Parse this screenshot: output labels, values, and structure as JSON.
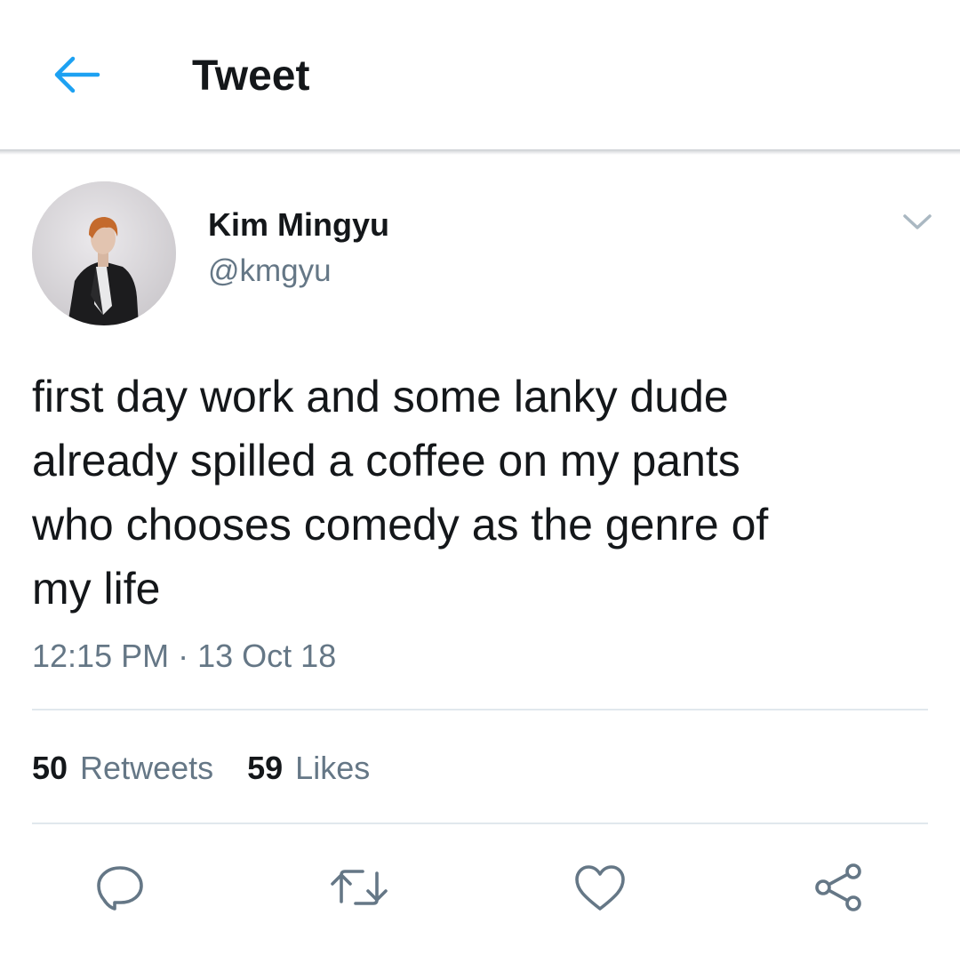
{
  "header": {
    "title": "Tweet",
    "back_icon": "arrow-left-icon",
    "accent_color": "#1da1f2"
  },
  "author": {
    "display_name": "Kim Mingyu",
    "handle": "@kmgyu",
    "menu_icon": "chevron-down-icon"
  },
  "tweet": {
    "text": "first day work and some lanky dude\nalready spilled a coffee on my pants\nwho chooses comedy as the genre of\nmy life",
    "time": "12:15 PM",
    "separator": "·",
    "date": "13 Oct 18"
  },
  "stats": {
    "retweets_count": "50",
    "retweets_label": "Retweets",
    "likes_count": "59",
    "likes_label": "Likes"
  },
  "actions": [
    {
      "icon": "reply-icon"
    },
    {
      "icon": "retweet-icon"
    },
    {
      "icon": "like-heart-icon"
    },
    {
      "icon": "share-icon"
    }
  ],
  "colors": {
    "text_primary": "#14171a",
    "text_secondary": "#657786",
    "divider": "#e1e8ed"
  }
}
